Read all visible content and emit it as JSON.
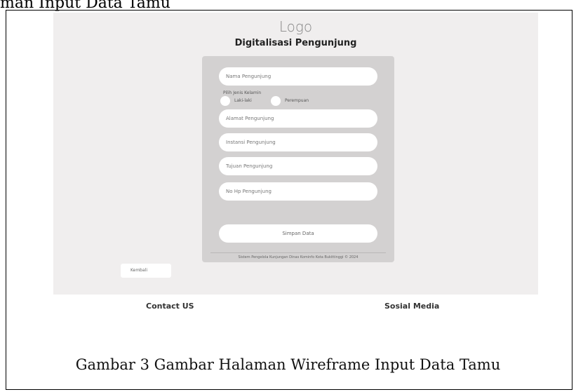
{
  "document": {
    "heading_fragment": "man Input Data Tamu",
    "caption": "Gambar  3 Gambar Halaman Wireframe Input Data Tamu"
  },
  "wireframe": {
    "logo": "Logo",
    "title": "Digitalisasi Pengunjung",
    "form": {
      "name_placeholder": "Nama Pengunjung",
      "gender_label": "Pilih Jenis Kelamin",
      "gender_options": [
        "Laki-laki",
        "Perempuan"
      ],
      "address_placeholder": "Alamat Pengunjung",
      "institution_placeholder": "Instansi Pengunjung",
      "purpose_placeholder": "Tujuan Pengunjung",
      "phone_placeholder": "No Hp Pengunjung",
      "save_label": "Simpan Data",
      "footer_note": "Sistem Pengelola Kunjungan Dinas Kominfo Kota Bukittinggi © 2024"
    },
    "back_label": "Kembali",
    "footer": {
      "contact": "Contact US",
      "social": "Sosial Media"
    }
  }
}
